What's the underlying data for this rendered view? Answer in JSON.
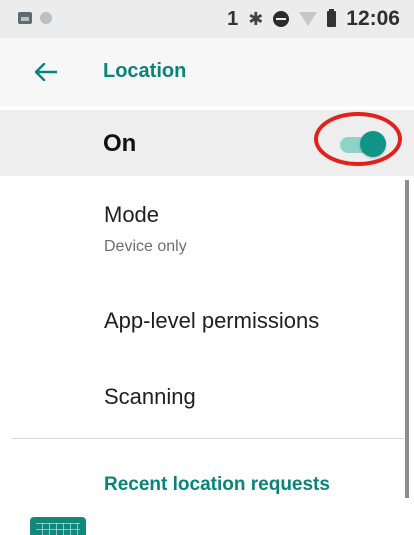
{
  "status_bar": {
    "sim_indicator": "1",
    "time": "12:06",
    "icons": [
      "image-notification-icon",
      "dot-icon",
      "bluetooth-icon",
      "dnd-icon",
      "wifi-icon",
      "battery-icon"
    ]
  },
  "toolbar": {
    "title": "Location",
    "back_icon": "arrow-back-icon"
  },
  "master_switch": {
    "label": "On",
    "enabled": true,
    "highlighted": true
  },
  "items": [
    {
      "title": "Mode",
      "summary": "Device only"
    },
    {
      "title": "App-level permissions"
    },
    {
      "title": "Scanning"
    }
  ],
  "section": {
    "title": "Recent location requests"
  },
  "colors": {
    "accent": "#0a8478",
    "toggle_thumb": "#109486",
    "toggle_track": "#8fd2c9",
    "highlight": "#e3201b",
    "status_bar_bg": "#ececec",
    "switch_row_bg": "#eeeeee"
  }
}
